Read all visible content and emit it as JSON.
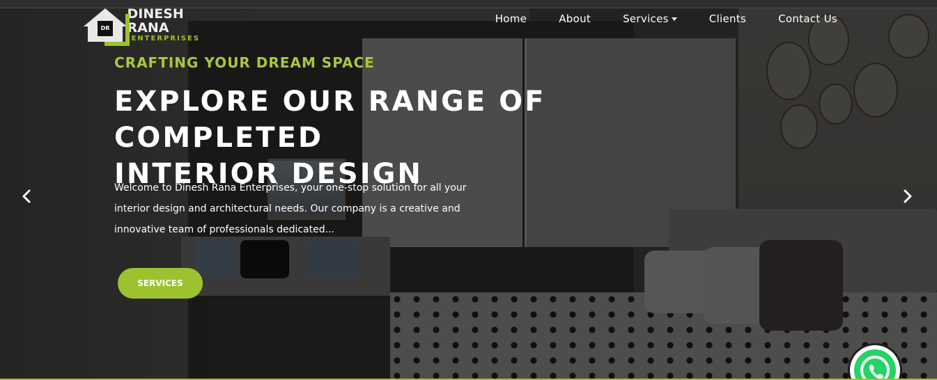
{
  "brand": {
    "name": "DINESH RANA",
    "subtitle": "ENTERPRISES",
    "initials": "DR",
    "accent_color": "#9cc32f"
  },
  "nav": {
    "items": [
      {
        "label": "Home"
      },
      {
        "label": "About"
      },
      {
        "label": "Services",
        "has_dropdown": true
      },
      {
        "label": "Clients"
      },
      {
        "label": "Contact Us"
      }
    ]
  },
  "hero": {
    "kicker": "CRAFTING YOUR DREAM SPACE",
    "headline_line1": "EXPLORE OUR RANGE OF COMPLETED",
    "headline_line2": "INTERIOR DESIGN",
    "description": "Welcome to Dinesh Rana Enterprises, your one-stop solution for all your interior design and architectural needs. Our company is a creative and innovative team of professionals dedicated...",
    "cta_label": "SERVICES"
  },
  "carousel": {
    "prev_icon": "chevron-left-icon",
    "next_icon": "chevron-right-icon"
  },
  "floating": {
    "whatsapp_icon": "whatsapp-icon",
    "whatsapp_color": "#25d366"
  }
}
